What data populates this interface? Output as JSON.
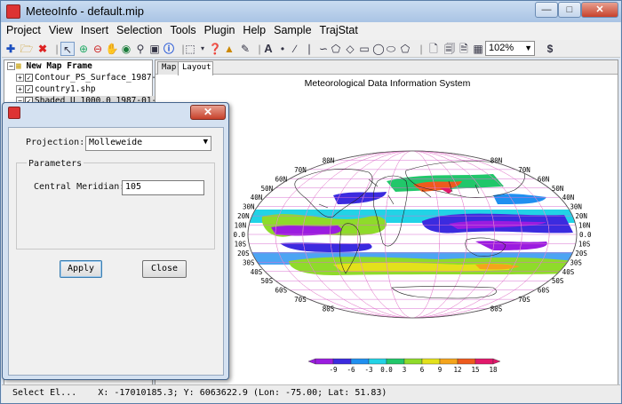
{
  "window": {
    "title": "MeteoInfo - default.mip"
  },
  "menu": [
    "Project",
    "View",
    "Insert",
    "Selection",
    "Tools",
    "Plugin",
    "Help",
    "Sample",
    "TrajStat"
  ],
  "toolbar": {
    "zoom": "102%"
  },
  "layers": {
    "frame": "New Map Frame",
    "items": [
      "Contour_PS_Surface_1987-01-",
      "country1.shp",
      "Shaded_U_1000.0_1987-01-01"
    ]
  },
  "tabs": [
    "Map",
    "Layout"
  ],
  "map": {
    "title": "Meteorological Data Information System",
    "lat_left": [
      "80N",
      "70N",
      "60N",
      "50N",
      "40N",
      "30N",
      "20N",
      "10N",
      "0.0",
      "10S",
      "20S",
      "30S",
      "40S",
      "50S",
      "60S",
      "70S",
      "80S"
    ],
    "lat_right": [
      "80N",
      "70N",
      "60N",
      "50N",
      "40N",
      "30N",
      "20N",
      "10N",
      "0.0",
      "10S",
      "20S",
      "30S",
      "40S",
      "50S",
      "60S",
      "70S",
      "80S"
    ],
    "legend": {
      "labels": [
        "-9",
        "-6",
        "-3",
        "0.0",
        "3",
        "6",
        "9",
        "12",
        "15",
        "18"
      ],
      "colors": [
        "#9b1ce0",
        "#3b2bdf",
        "#1f8ff0",
        "#22d3e6",
        "#21c76a",
        "#8fdb2a",
        "#e3e11b",
        "#f4a41b",
        "#ee5a1d",
        "#e2186b"
      ]
    }
  },
  "status": {
    "text": "Select El...    X: -17010185.3; Y: 6063622.9 (Lon: -75.00; Lat: 51.83)"
  },
  "dialog": {
    "projection_label": "Projection:",
    "projection_value": "Molleweide",
    "group_label": "Parameters",
    "central_meridian_label": "Central Meridian:",
    "central_meridian_value": "105",
    "apply_label": "Apply",
    "close_label": "Close"
  }
}
